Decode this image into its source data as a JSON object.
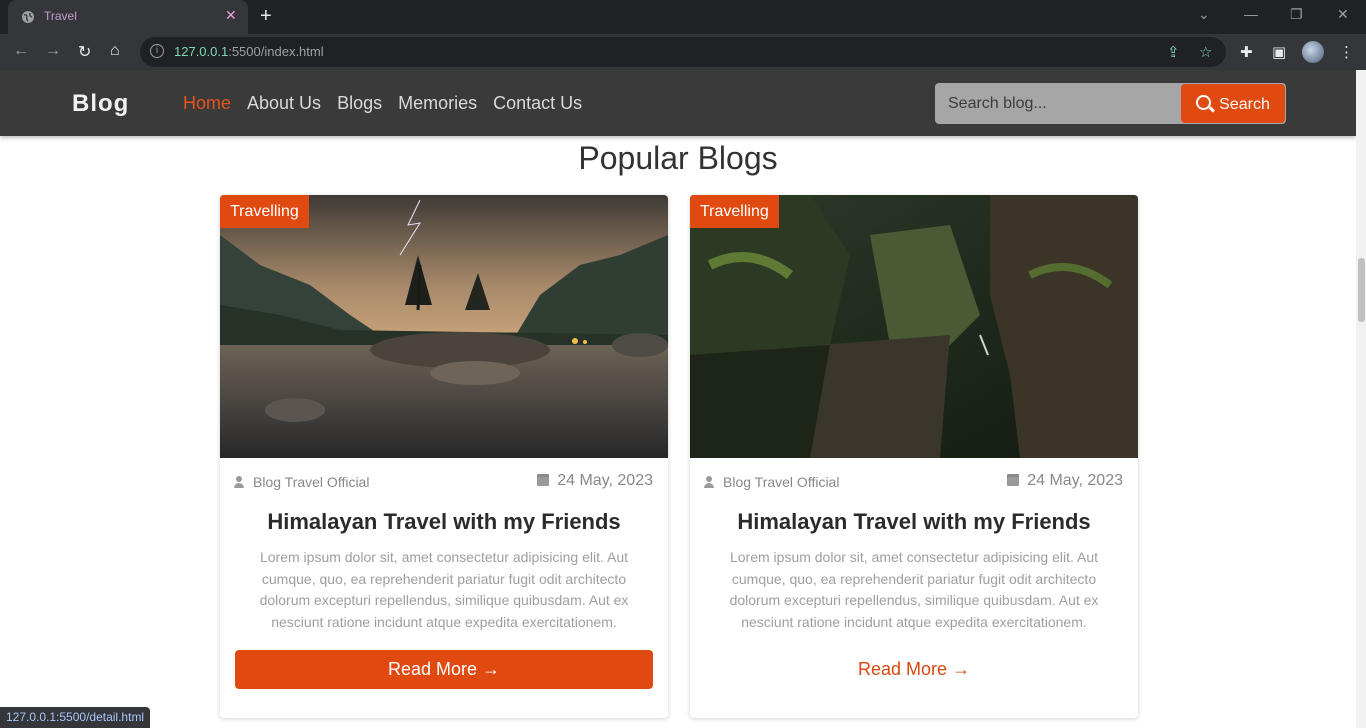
{
  "browser": {
    "tab_title": "Travel",
    "tab_close": "✕",
    "new_tab": "+",
    "url_host": "127.0.0.1",
    "url_rest": ":5500/index.html",
    "status_url": "127.0.0.1:5500/detail.html",
    "icons": [
      "back-icon",
      "forward-icon",
      "reload-icon",
      "home-icon",
      "info-icon",
      "share-icon",
      "star-icon",
      "extensions-icon",
      "sidepanel-icon",
      "menu-icon"
    ]
  },
  "site": {
    "logo": "Blog",
    "nav": [
      {
        "label": "Home",
        "active": true
      },
      {
        "label": "About Us"
      },
      {
        "label": "Blogs"
      },
      {
        "label": "Memories"
      },
      {
        "label": "Contact Us"
      }
    ],
    "search_placeholder": "Search blog...",
    "search_button": "Search",
    "accent_color": "#e04a10"
  },
  "main": {
    "section_title": "Popular Blogs",
    "cards": [
      {
        "badge": "Travelling",
        "author": "Blog Travel Official",
        "date": "24 May, 2023",
        "title": "Himalayan Travel with my Friends",
        "text": "Lorem ipsum dolor sit, amet consectetur adipisicing elit. Aut cumque, quo, ea reprehenderit pariatur fugit odit architecto dolorum excepturi repellendus, similique quibusdam. Aut ex nesciunt ratione incidunt atque expedita exercitationem.",
        "button": "Read More →"
      },
      {
        "badge": "Travelling",
        "author": "Blog Travel Official",
        "date": "24 May, 2023",
        "title": "Himalayan Travel with my Friends",
        "text": "Lorem ipsum dolor sit, amet consectetur adipisicing elit. Aut cumque, quo, ea reprehenderit pariatur fugit odit architecto dolorum excepturi repellendus, similique quibusdam. Aut ex nesciunt ratione incidunt atque expedita exercitationem.",
        "button": "Read More →"
      }
    ]
  }
}
